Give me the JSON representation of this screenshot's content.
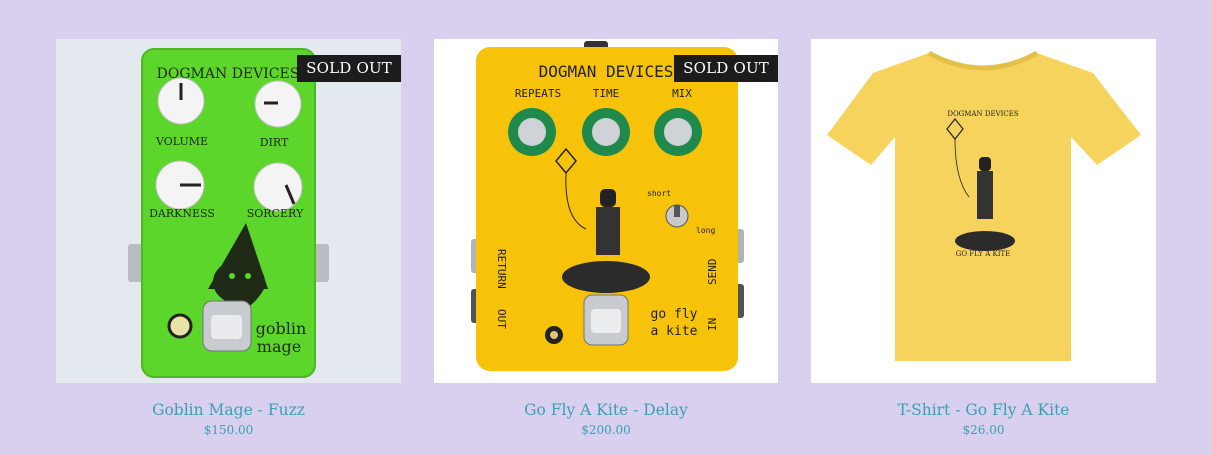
{
  "products": [
    {
      "title": "Goblin Mage - Fuzz",
      "price": "$150.00",
      "badge": "SOLD OUT",
      "image": {
        "brand": "DOGMAN DEVICES",
        "knobs": [
          "VOLUME",
          "DIRT",
          "DARKNESS",
          "SORCERY"
        ],
        "logo": [
          "goblin",
          "mage"
        ]
      }
    },
    {
      "title": "Go Fly A Kite - Delay",
      "price": "$200.00",
      "badge": "SOLD OUT",
      "image": {
        "brand": "DOGMAN DEVICES",
        "knobs": [
          "REPEATS",
          "TIME",
          "MIX"
        ],
        "switch_labels": [
          "short",
          "long"
        ],
        "side_left": [
          "RETURN",
          "OUT"
        ],
        "side_right": [
          "SEND",
          "IN"
        ],
        "logo": [
          "go fly",
          "a kite"
        ]
      }
    },
    {
      "title": "T-Shirt - Go Fly A Kite",
      "price": "$26.00",
      "image": {
        "brand": "DOGMAN DEVICES",
        "caption": "GO FLY A KITE"
      }
    }
  ],
  "colors": {
    "background": "#d8d0ee",
    "link": "#3aa0b4",
    "badge_bg": "#1c1c1c",
    "green_pedal": "#5cd62a",
    "yellow_pedal": "#f7c20a",
    "shirt": "#f5d35c"
  }
}
